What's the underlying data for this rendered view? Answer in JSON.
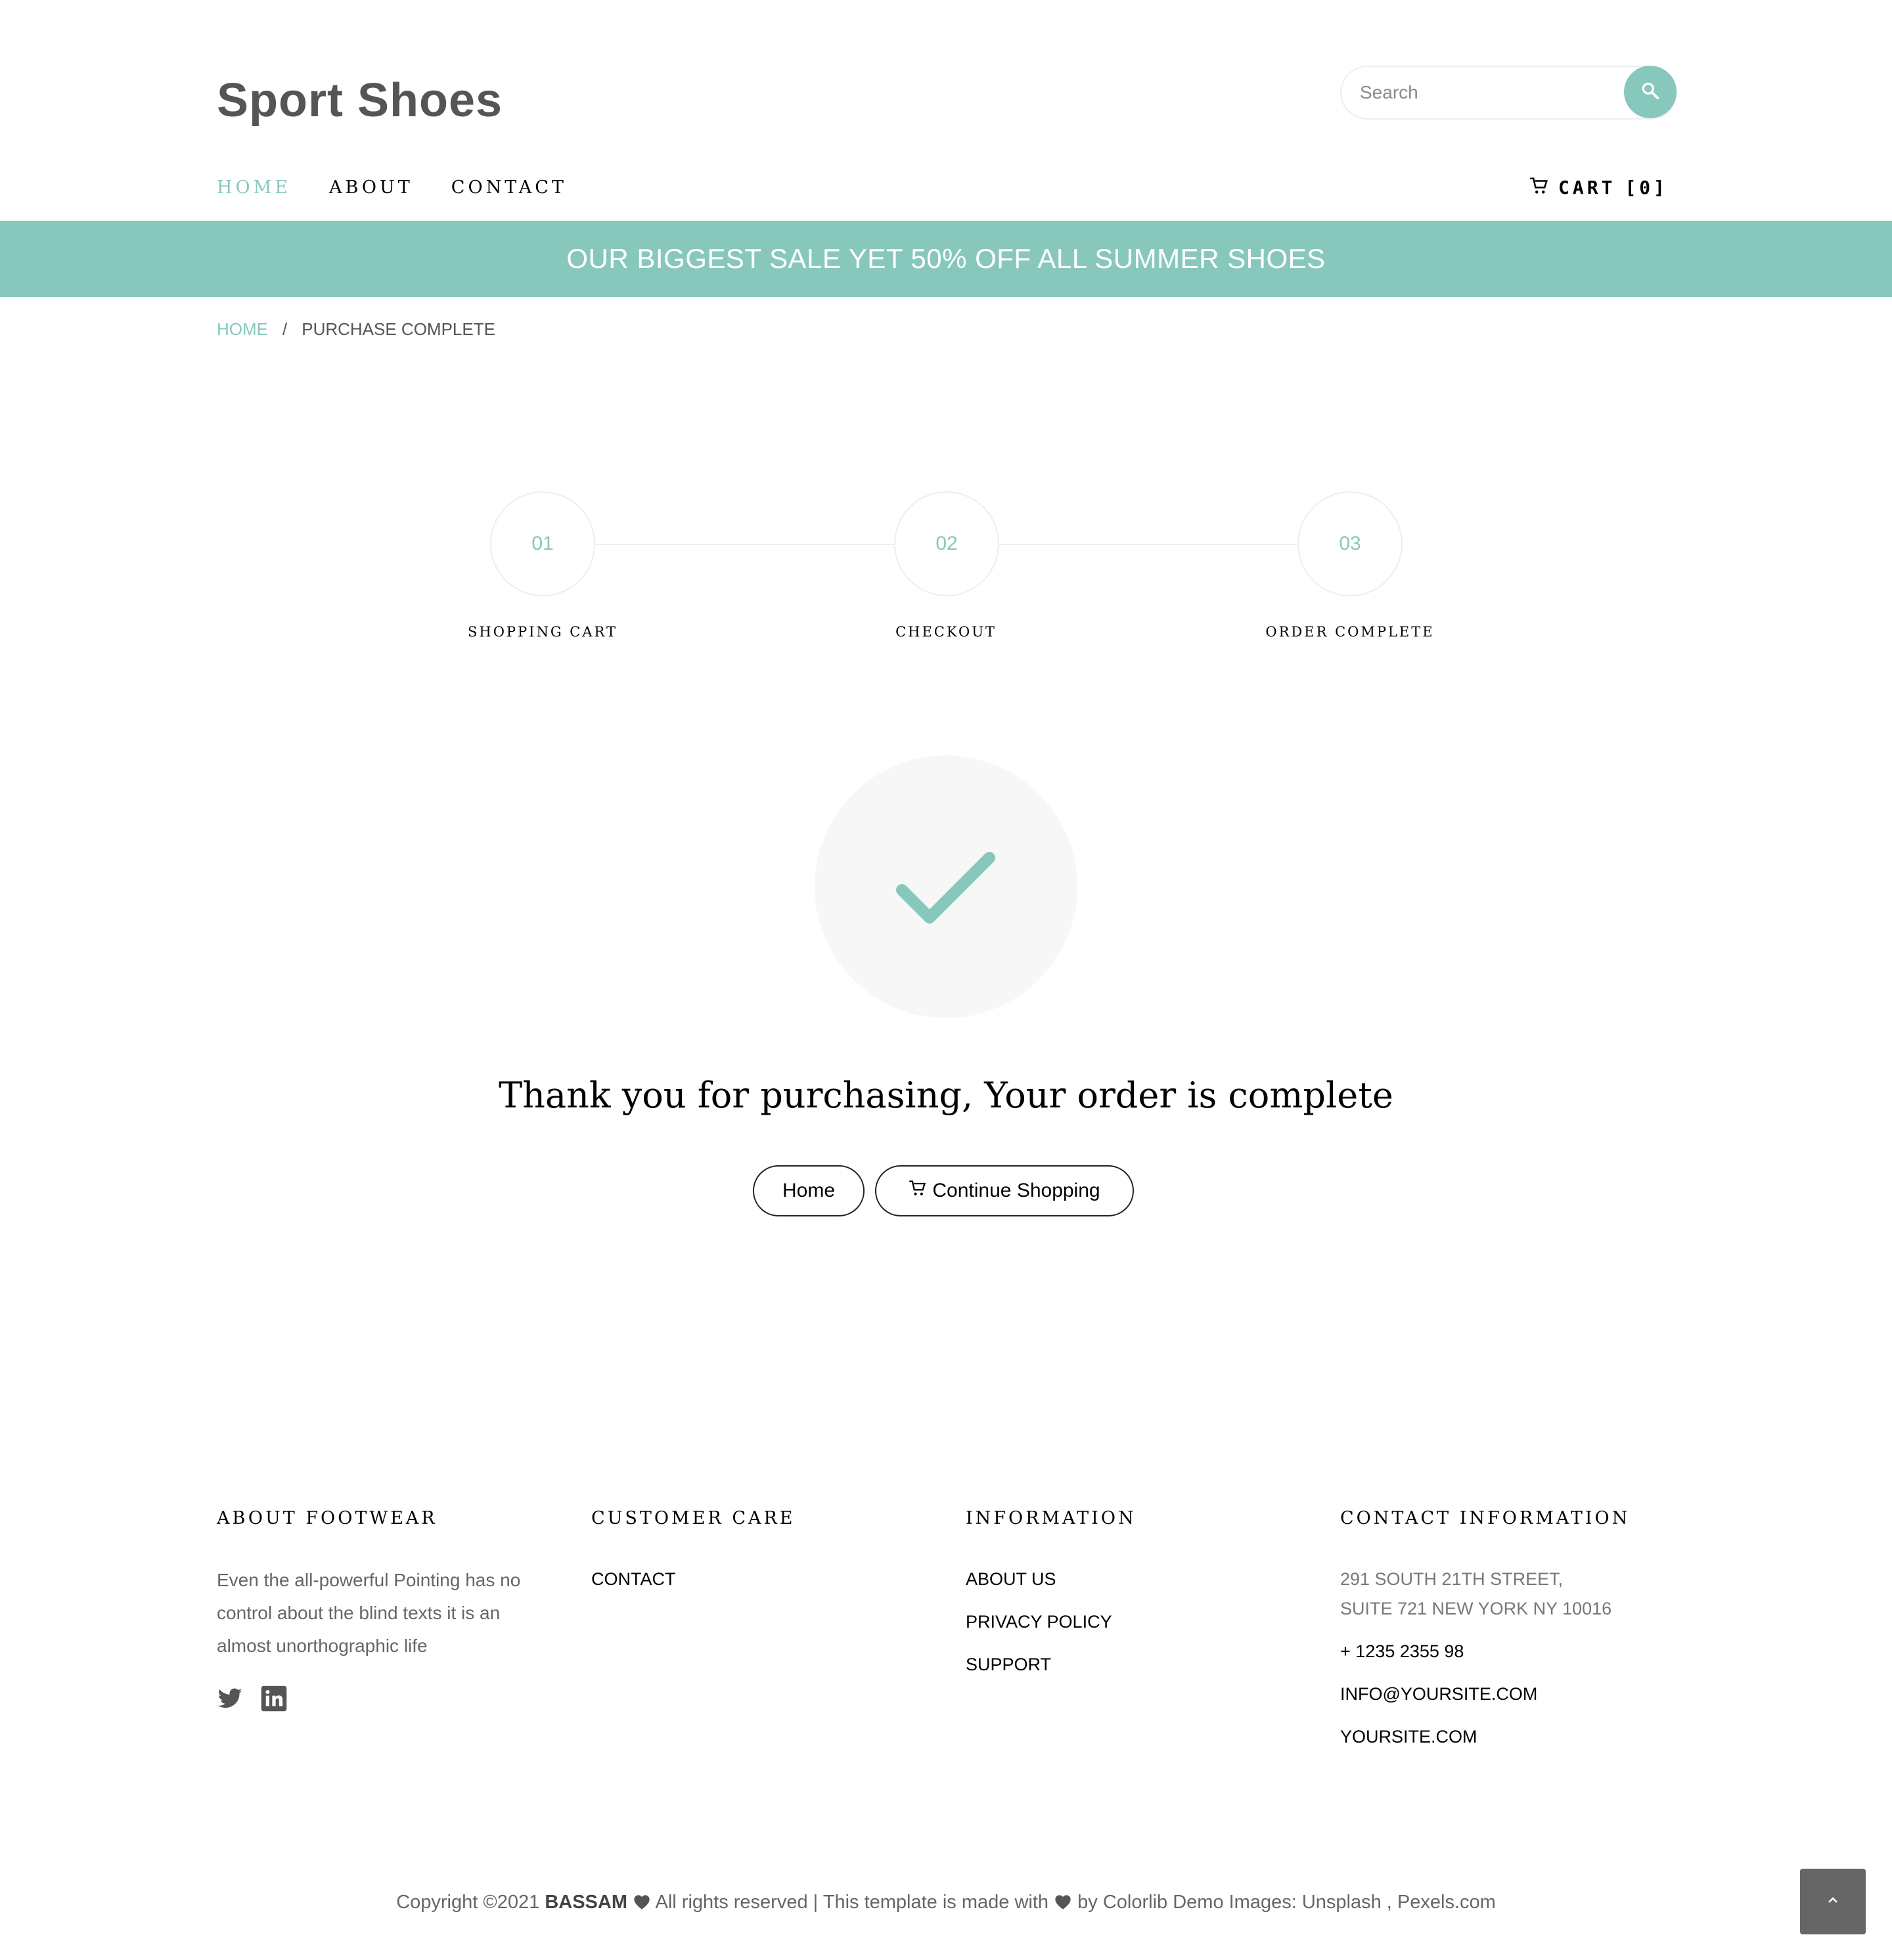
{
  "header": {
    "logo": "Sport Shoes",
    "search_placeholder": "Search",
    "nav": [
      "HOME",
      "ABOUT",
      "CONTACT"
    ],
    "cart_label": "CART",
    "cart_count": "[0]"
  },
  "banner": {
    "text": "OUR BIGGEST SALE YET 50% OFF ALL SUMMER SHOES"
  },
  "breadcrumb": {
    "home": "HOME",
    "separator": "/",
    "current": "PURCHASE COMPLETE"
  },
  "steps": [
    {
      "number": "01",
      "label": "SHOPPING CART"
    },
    {
      "number": "02",
      "label": "CHECKOUT"
    },
    {
      "number": "03",
      "label": "ORDER COMPLETE"
    }
  ],
  "success": {
    "message": "Thank you for purchasing, Your order is complete",
    "home_button": "Home",
    "continue_button": "Continue Shopping"
  },
  "footer": {
    "about": {
      "heading": "ABOUT FOOTWEAR",
      "text": "Even the all-powerful Pointing has no control about the blind texts it is an almost unorthographic life"
    },
    "customer_care": {
      "heading": "CUSTOMER CARE",
      "links": [
        "CONTACT"
      ]
    },
    "information": {
      "heading": "INFORMATION",
      "links": [
        "ABOUT US",
        "PRIVACY POLICY",
        "SUPPORT"
      ]
    },
    "contact": {
      "heading": "CONTACT INFORMATION",
      "address_line1": "291 SOUTH 21TH STREET,",
      "address_line2": "SUITE 721 NEW YORK NY 10016",
      "phone": "+ 1235 2355 98",
      "email": "INFO@YOURSITE.COM",
      "website": "YOURSITE.COM"
    },
    "copyright": {
      "prefix": "Copyright ©2021",
      "owner": "BASSAM",
      "middle": "All rights reserved | This template is made with",
      "suffix": "by Colorlib Demo Images: Unsplash , Pexels.com"
    }
  },
  "colors": {
    "accent": "#88c8bc",
    "text": "#000000",
    "muted": "#666666"
  }
}
